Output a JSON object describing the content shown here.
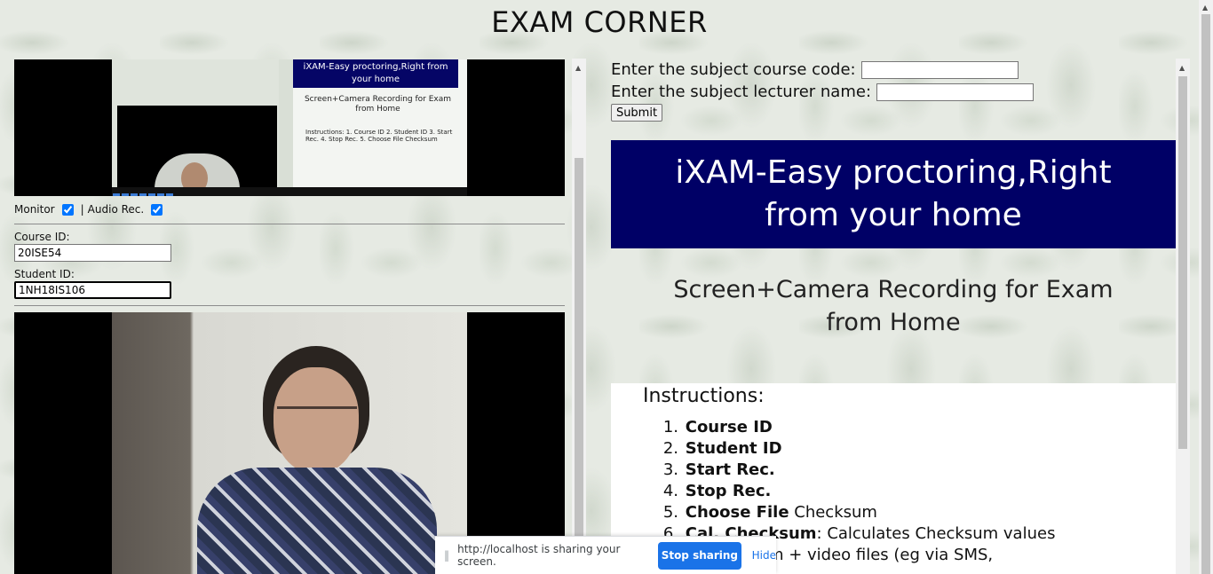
{
  "page": {
    "title": "EXAM CORNER"
  },
  "left": {
    "monitor_label": "Monitor",
    "separator": "|",
    "audio_label": "Audio Rec.",
    "monitor_checked": true,
    "audio_checked": true,
    "course_id_label": "Course ID:",
    "course_id_value": "20ISE54",
    "student_id_label": "Student ID:",
    "student_id_value": "1NH18IS106"
  },
  "right": {
    "course_code_label": "Enter the subject course code:",
    "lecturer_label": "Enter the subject lecturer name:",
    "submit_label": "Submit",
    "banner_line1": "iXAM-Easy proctoring,Right",
    "banner_line2": "from your home",
    "subtitle_line1": "Screen+Camera Recording for Exam",
    "subtitle_line2": "from Home",
    "instructions_title": "Instructions:",
    "instructions": [
      {
        "num": "1.",
        "bold": "Course ID",
        "rest": ""
      },
      {
        "num": "2.",
        "bold": "Student ID",
        "rest": ""
      },
      {
        "num": "3.",
        "bold": "Start Rec.",
        "rest": ""
      },
      {
        "num": "4.",
        "bold": "Stop Rec.",
        "rest": ""
      },
      {
        "num": "5.",
        "bold": "Choose File",
        "rest": " Checksum"
      },
      {
        "num": "6.",
        "bold": "Cal. Checksum",
        "rest": ": Calculates Checksum values"
      },
      {
        "num": "",
        "bold": "",
        "rest": "ksum + video files (eg via SMS,"
      }
    ]
  },
  "share_bar": {
    "message": "http://localhost is sharing your screen.",
    "stop_label": "Stop sharing",
    "hide_label": "Hide"
  },
  "mini_preview": {
    "banner": "iXAM-Easy proctoring,Right from your home",
    "subtitle": "Screen+Camera Recording for Exam from Home",
    "instructions": "Instructions: 1. Course ID 2. Student ID 3. Start Rec. 4. Stop Rec. 5. Choose File Checksum"
  },
  "colors": {
    "banner_bg": "#000066",
    "stop_button": "#1a73e8",
    "link": "#1a73e8"
  }
}
